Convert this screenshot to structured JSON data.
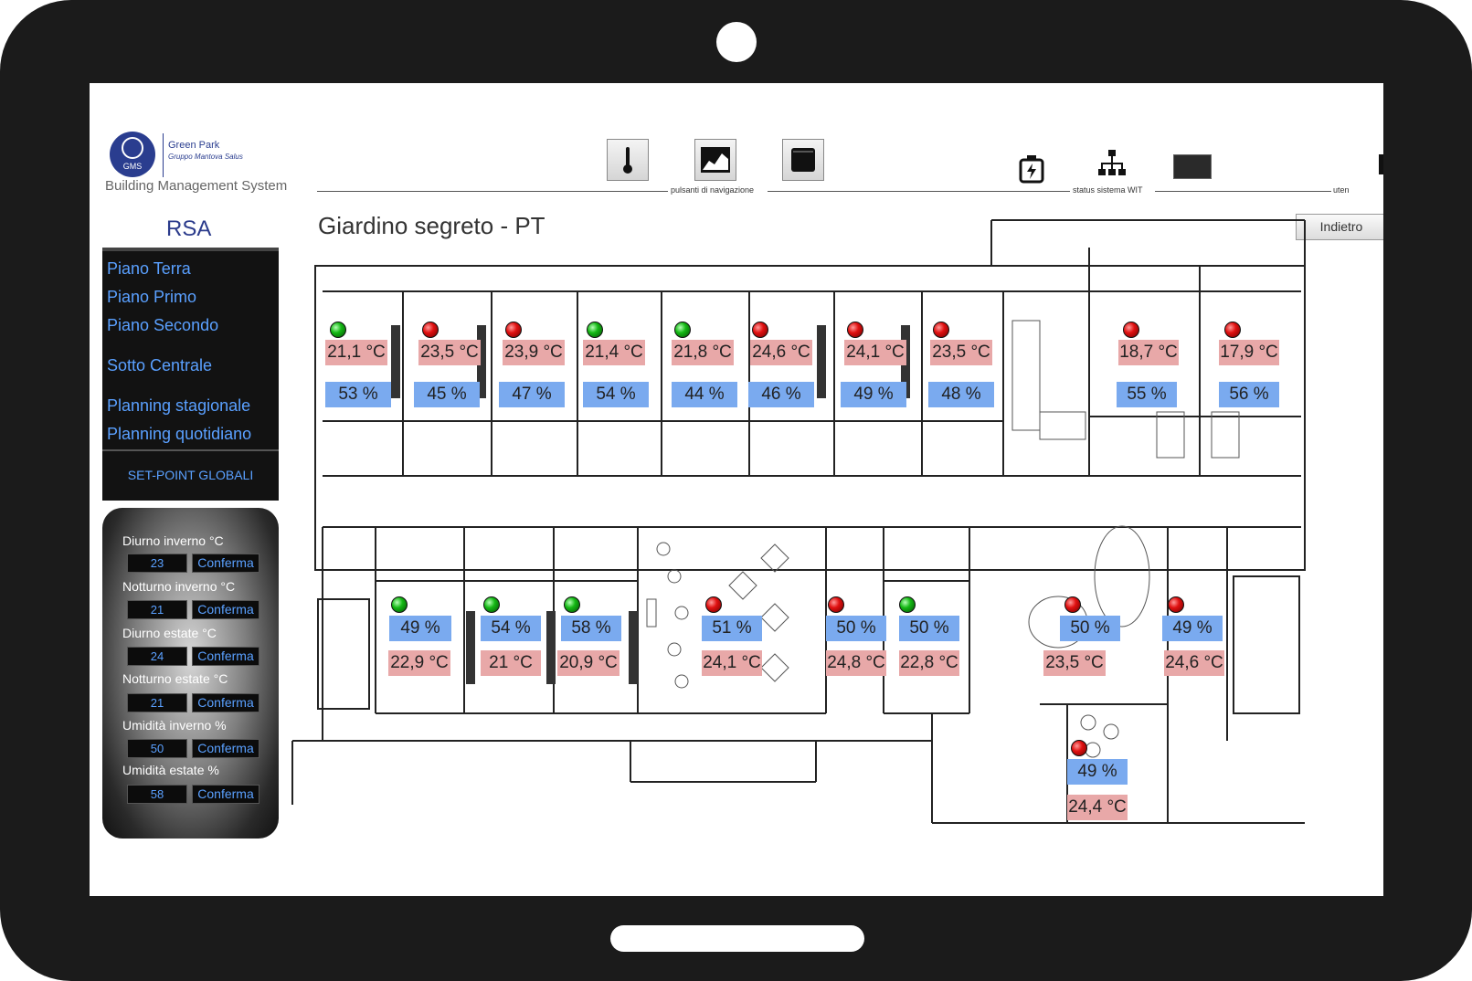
{
  "header": {
    "logo": {
      "name": "Green Park",
      "subtitle": "Gruppo Mantova Salus",
      "badge": "GMS"
    },
    "app_title": "Building Management System",
    "nav_group_label": "pulsanti di navigazione",
    "status_group_label": "status sistema WIT",
    "user_label_partial": "uten",
    "nav_buttons": [
      {
        "icon": "thermometer-icon"
      },
      {
        "icon": "chart-icon"
      },
      {
        "icon": "book-icon"
      }
    ],
    "status_icons": [
      "battery-power-icon",
      "network-tree-icon",
      "wit-device-icon"
    ]
  },
  "sidebar": {
    "section_title": "RSA",
    "menu": [
      {
        "label": "Piano Terra"
      },
      {
        "label": "Piano Primo"
      },
      {
        "label": "Piano Secondo"
      },
      {
        "label": "Sotto Centrale"
      },
      {
        "label": "Planning stagionale"
      },
      {
        "label": "Planning quotidiano"
      }
    ],
    "setpoint_title": "SET-POINT GLOBALI",
    "setpoints": [
      {
        "label": "Diurno inverno °C",
        "value": "23",
        "button": "Conferma"
      },
      {
        "label": "Notturno inverno °C",
        "value": "21",
        "button": "Conferma"
      },
      {
        "label": "Diurno estate °C",
        "value": "24",
        "button": "Conferma"
      },
      {
        "label": "Notturno estate °C",
        "value": "21",
        "button": "Conferma"
      },
      {
        "label": "Umidità inverno %",
        "value": "50",
        "button": "Conferma"
      },
      {
        "label": "Umidità estate %",
        "value": "58",
        "button": "Conferma"
      }
    ]
  },
  "main": {
    "title": "Giardino segreto - PT",
    "back_button": "Indietro"
  },
  "rooms": [
    {
      "status": "green",
      "temperature": "21,1 °C",
      "humidity": "53 %"
    },
    {
      "status": "red",
      "temperature": "23,5 °C",
      "humidity": "45 %"
    },
    {
      "status": "red",
      "temperature": "23,9 °C",
      "humidity": "47 %"
    },
    {
      "status": "green",
      "temperature": "21,4 °C",
      "humidity": "54 %"
    },
    {
      "status": "green",
      "temperature": "21,8 °C",
      "humidity": "44 %"
    },
    {
      "status": "red",
      "temperature": "24,6 °C",
      "humidity": "46 %"
    },
    {
      "status": "red",
      "temperature": "24,1 °C",
      "humidity": "49 %"
    },
    {
      "status": "red",
      "temperature": "23,5 °C",
      "humidity": "48 %"
    },
    {
      "status": "red",
      "temperature": "18,7 °C",
      "humidity": "55 %"
    },
    {
      "status": "red",
      "temperature": "17,9 °C",
      "humidity": "56 %"
    },
    {
      "status": "green",
      "temperature": "22,9 °C",
      "humidity": "49 %"
    },
    {
      "status": "green",
      "temperature": "21 °C",
      "humidity": "54 %"
    },
    {
      "status": "green",
      "temperature": "20,9 °C",
      "humidity": "58 %"
    },
    {
      "status": "red",
      "temperature": "24,1 °C",
      "humidity": "51 %"
    },
    {
      "status": "red",
      "temperature": "24,8 °C",
      "humidity": "50 %"
    },
    {
      "status": "green",
      "temperature": "22,8 °C",
      "humidity": "50 %"
    },
    {
      "status": "red",
      "temperature": "23,5 °C",
      "humidity": "50 %"
    },
    {
      "status": "red",
      "temperature": "24,6 °C",
      "humidity": "49 %"
    },
    {
      "status": "red",
      "temperature": "24,4 °C",
      "humidity": "49 %"
    }
  ],
  "colors": {
    "frame": "#1b1b1b",
    "brand": "#2c3c8c",
    "menu_text": "#5aa0ff",
    "temp_bg": "#e8a8a8",
    "humidity_bg": "#7aaaef",
    "alarm": "#e01010",
    "ok": "#14b814"
  }
}
